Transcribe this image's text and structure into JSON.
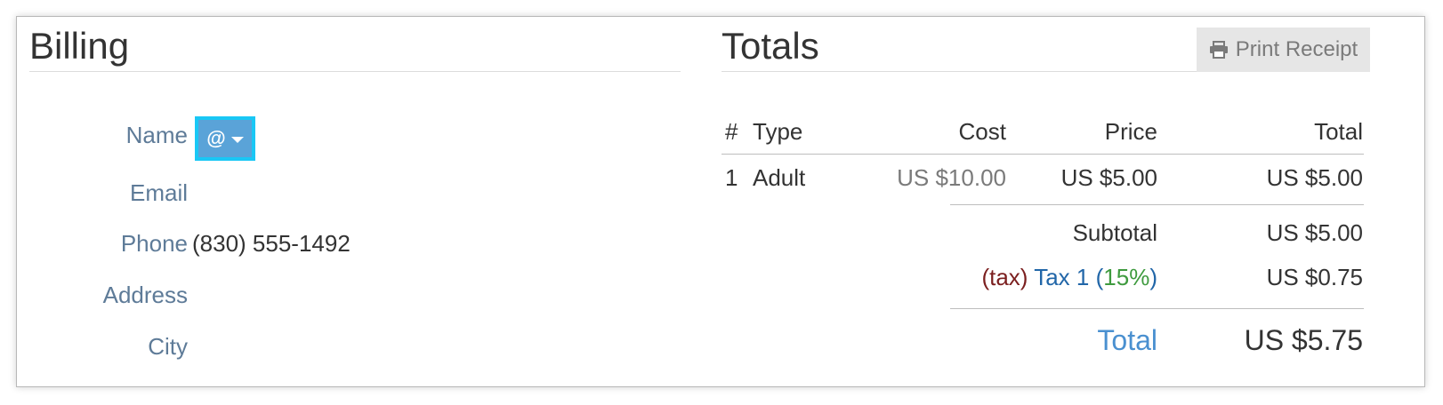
{
  "billing": {
    "title": "Billing",
    "fields": {
      "name_label": "Name",
      "name_button_symbol": "@",
      "email_label": "Email",
      "phone_label": "Phone",
      "phone_value": "(830) 555-1492",
      "address_label": "Address",
      "city_label": "City"
    }
  },
  "totals": {
    "title": "Totals",
    "print_button_label": "Print Receipt",
    "columns": [
      "#",
      "Type",
      "Cost",
      "Price",
      "Total"
    ],
    "rows": [
      {
        "num": "1",
        "type": "Adult",
        "cost": "US $10.00",
        "price": "US $5.00",
        "total": "US $5.00"
      }
    ],
    "subtotal_label": "Subtotal",
    "subtotal_value": "US $5.00",
    "tax_prefix": "(tax)",
    "tax_name": "Tax 1",
    "tax_rate_open": "(",
    "tax_rate": "15%",
    "tax_rate_close": ")",
    "tax_value": "US $0.75",
    "total_label": "Total",
    "total_value": "US $5.75"
  },
  "colors": {
    "label_blue": "#5e7b98",
    "highlight_border": "#19c7f5",
    "button_blue": "#5aa3d8",
    "tax_paren": "#7b1f1f",
    "tax_name": "#2166a8",
    "tax_rate": "#3e9a3e",
    "total_label": "#4a90d0"
  }
}
